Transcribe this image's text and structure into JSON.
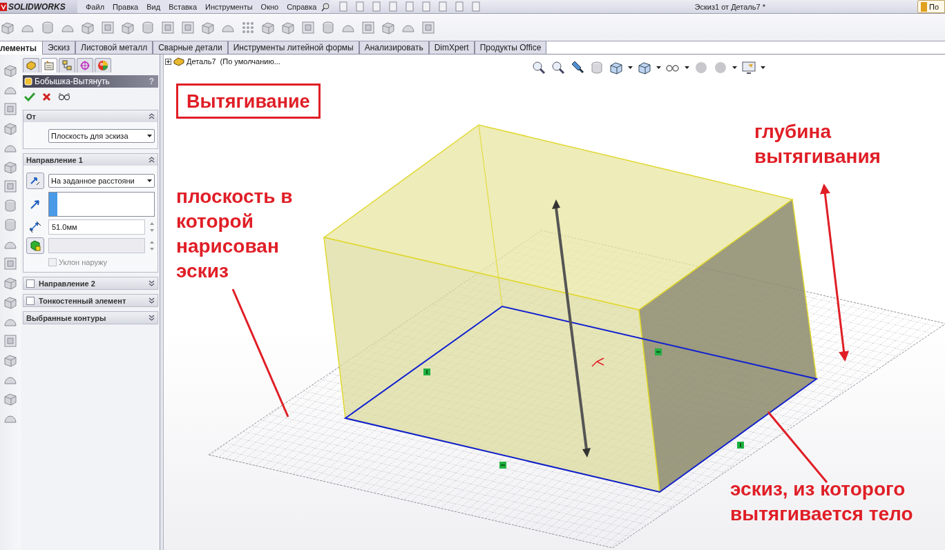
{
  "title_bar": {
    "logo": "SOLIDWORKS",
    "menu": [
      "Файл",
      "Правка",
      "Вид",
      "Вставка",
      "Инструменты",
      "Окно",
      "Справка"
    ],
    "title": "Эскиз1 от Деталь7 *",
    "corner_button": "По"
  },
  "command_tabs": [
    {
      "label": "лементы",
      "selected": true
    },
    {
      "label": "Эскиз",
      "selected": false
    },
    {
      "label": "Листовой металл",
      "selected": false
    },
    {
      "label": "Сварные детали",
      "selected": false
    },
    {
      "label": "Инструменты литейной формы",
      "selected": false
    },
    {
      "label": "Анализировать",
      "selected": false
    },
    {
      "label": "DimXpert",
      "selected": false
    },
    {
      "label": "Продукты Office",
      "selected": false
    }
  ],
  "property_manager": {
    "panel_tabs": [
      {
        "kind": "feature",
        "selected": false
      },
      {
        "kind": "property",
        "selected": true
      },
      {
        "kind": "config",
        "selected": false
      },
      {
        "kind": "dimxpert",
        "selected": false
      },
      {
        "kind": "display",
        "selected": false
      }
    ],
    "title": "Бобышка-Вытянуть",
    "help": "?",
    "sections": [
      {
        "kind": "from",
        "title": "От",
        "expanded": true,
        "dropdown": "Плоскость для эскиза"
      },
      {
        "kind": "direction",
        "title": "Направление 1",
        "expanded": true,
        "dropdown": "На заданное расстояни",
        "depth": "51.0мм",
        "draft": {
          "label": "Уклон наружу",
          "checked": false,
          "disabled": true
        }
      },
      {
        "kind": "toggle",
        "title": "Направление 2",
        "checked": false,
        "expanded": false
      },
      {
        "kind": "toggle",
        "title": "Тонкостенный элемент",
        "checked": false,
        "expanded": false
      },
      {
        "kind": "plain",
        "title": "Выбранные контуры",
        "expanded": false
      }
    ]
  },
  "feature_tree": {
    "label": "Деталь7  (По умолчанию...",
    "expanded": false
  },
  "annotations": [
    {
      "kind": "boxed",
      "lines": [
        "Вытягивание"
      ]
    },
    {
      "kind": "note",
      "lines": [
        "глубина",
        "вытягивания"
      ]
    },
    {
      "kind": "note",
      "lines": [
        "плоскость в",
        "которой",
        "нарисован",
        "эскиз"
      ]
    },
    {
      "kind": "note",
      "lines": [
        "эскиз, из которого",
        "вытягивается тело"
      ]
    }
  ]
}
